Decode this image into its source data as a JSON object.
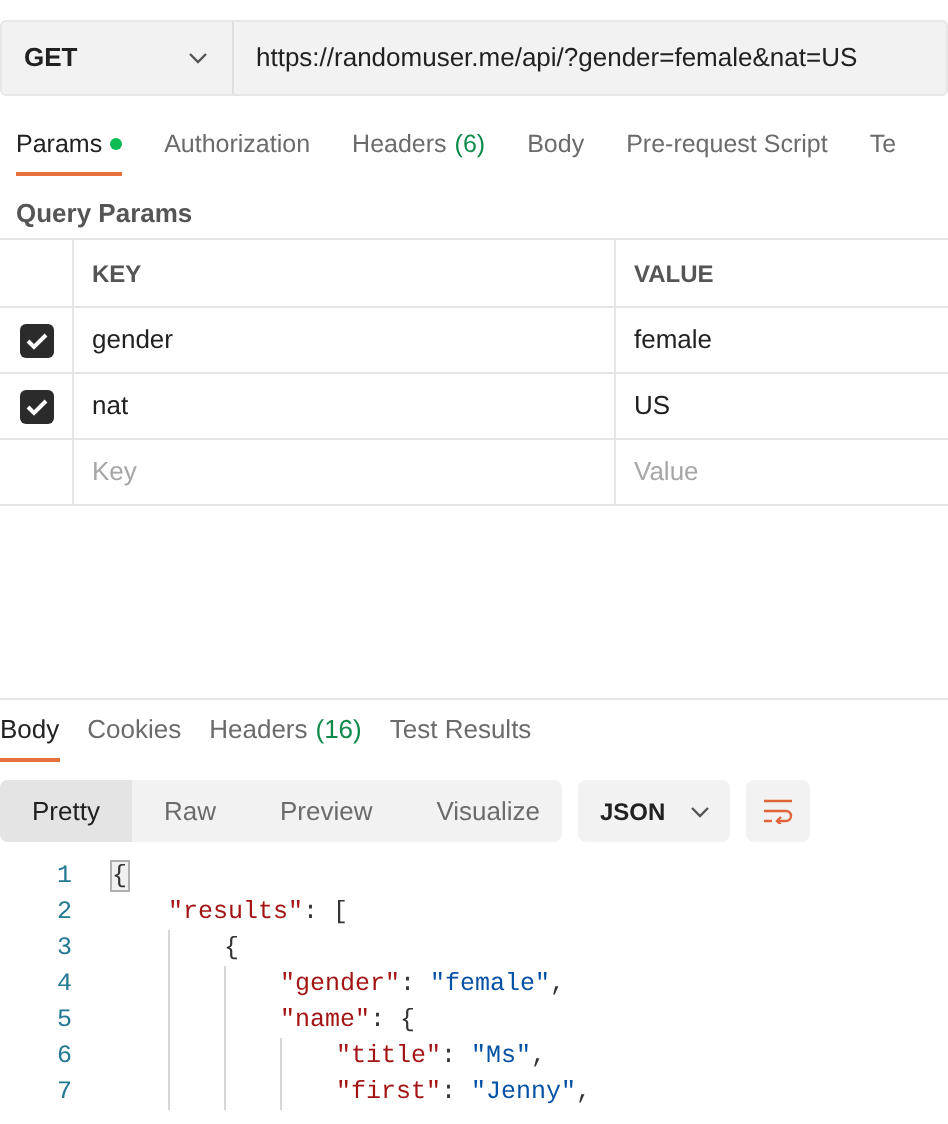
{
  "request": {
    "method": "GET",
    "url": "https://randomuser.me/api/?gender=female&nat=US"
  },
  "request_tabs": [
    {
      "label": "Params",
      "indicator": true,
      "selected": true
    },
    {
      "label": "Authorization",
      "indicator": false,
      "selected": false
    },
    {
      "label": "Headers",
      "count": "(6)",
      "indicator": false,
      "selected": false
    },
    {
      "label": "Body",
      "indicator": false,
      "selected": false
    },
    {
      "label": "Pre-request Script",
      "indicator": false,
      "selected": false
    },
    {
      "label": "Te",
      "indicator": false,
      "selected": false
    }
  ],
  "query_params": {
    "title": "Query Params",
    "columns": [
      "KEY",
      "VALUE"
    ],
    "rows": [
      {
        "checked": true,
        "key": "gender",
        "value": "female"
      },
      {
        "checked": true,
        "key": "nat",
        "value": "US"
      }
    ],
    "new_row": {
      "key_placeholder": "Key",
      "value_placeholder": "Value"
    }
  },
  "response_tabs": [
    {
      "label": "Body",
      "selected": true
    },
    {
      "label": "Cookies",
      "selected": false
    },
    {
      "label": "Headers",
      "count": "(16)",
      "selected": false
    },
    {
      "label": "Test Results",
      "selected": false
    }
  ],
  "view_modes": [
    {
      "label": "Pretty",
      "selected": true
    },
    {
      "label": "Raw",
      "selected": false
    },
    {
      "label": "Preview",
      "selected": false
    },
    {
      "label": "Visualize",
      "selected": false
    }
  ],
  "format": "JSON",
  "code": [
    {
      "number": "1",
      "tokens": [
        {
          "kind": "punct",
          "text": "{"
        }
      ],
      "cursor": true,
      "children": [
        {
          "number": "2",
          "tokens": [
            {
              "kind": "key",
              "text": "\"results\""
            },
            {
              "kind": "punct",
              "text": ": ["
            }
          ],
          "children": [
            {
              "number": "3",
              "tokens": [
                {
                  "kind": "punct",
                  "text": "{"
                }
              ],
              "children": [
                {
                  "number": "4",
                  "tokens": [
                    {
                      "kind": "key",
                      "text": "\"gender\""
                    },
                    {
                      "kind": "punct",
                      "text": ": "
                    },
                    {
                      "kind": "string",
                      "text": "\"female\""
                    },
                    {
                      "kind": "punct",
                      "text": ","
                    }
                  ]
                },
                {
                  "number": "5",
                  "tokens": [
                    {
                      "kind": "key",
                      "text": "\"name\""
                    },
                    {
                      "kind": "punct",
                      "text": ": {"
                    }
                  ],
                  "children": [
                    {
                      "number": "6",
                      "tokens": [
                        {
                          "kind": "key",
                          "text": "\"title\""
                        },
                        {
                          "kind": "punct",
                          "text": ": "
                        },
                        {
                          "kind": "string",
                          "text": "\"Ms\""
                        },
                        {
                          "kind": "punct",
                          "text": ","
                        }
                      ]
                    },
                    {
                      "number": "7",
                      "tokens": [
                        {
                          "kind": "key",
                          "text": "\"first\""
                        },
                        {
                          "kind": "punct",
                          "text": ": "
                        },
                        {
                          "kind": "string",
                          "text": "\"Jenny\""
                        },
                        {
                          "kind": "punct",
                          "text": ","
                        }
                      ]
                    }
                  ]
                }
              ]
            }
          ]
        }
      ]
    }
  ]
}
